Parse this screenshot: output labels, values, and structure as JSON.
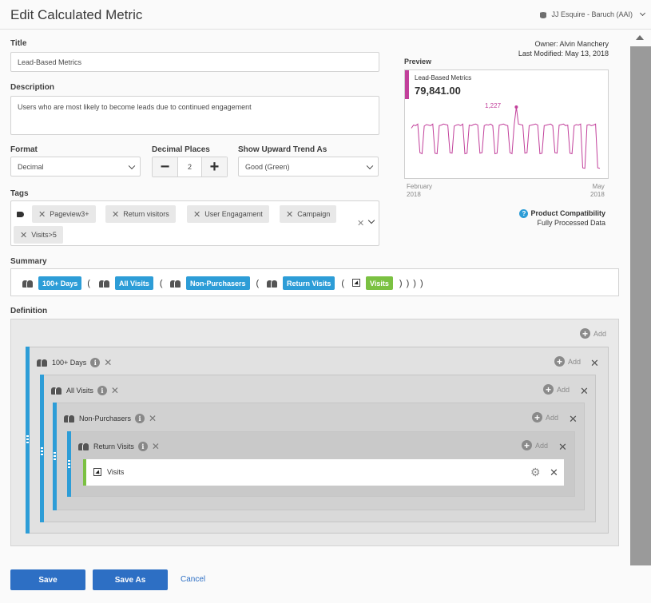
{
  "header": {
    "title": "Edit Calculated Metric",
    "account": "JJ Esquire - Baruch (AAI)"
  },
  "form": {
    "title_label": "Title",
    "title_value": "Lead-Based Metrics",
    "description_label": "Description",
    "description_value": "Users who are most likely to become leads due to continued engagement",
    "format_label": "Format",
    "format_value": "Decimal",
    "decimal_label": "Decimal Places",
    "decimal_value": "2",
    "trend_label": "Show Upward Trend As",
    "trend_value": "Good (Green)",
    "tags_label": "Tags",
    "tags": [
      "Pageview3+",
      "Return visitors",
      "User Engagament",
      "Campaign",
      "Visits>5"
    ]
  },
  "meta": {
    "owner": "Owner: Alvin Manchery",
    "modified": "Last Modified: May 13, 2018"
  },
  "preview": {
    "label": "Preview",
    "metric_name": "Lead-Based Metrics",
    "total": "79,841.00",
    "peak_label": "1,227",
    "start_month": "February",
    "start_year": "2018",
    "end_month": "May",
    "end_year": "2018",
    "line_color": "#c2409b"
  },
  "chart_data": {
    "type": "line",
    "series": [
      {
        "values": [
          820,
          880,
          870,
          900,
          350,
          330,
          860,
          890,
          880,
          870,
          900,
          340,
          330,
          870,
          880,
          900,
          890,
          880,
          350,
          340,
          860,
          880,
          890,
          870,
          900,
          330,
          340,
          880,
          870,
          890,
          900,
          880,
          340,
          350,
          870,
          890,
          880,
          900,
          870,
          330,
          340,
          880,
          890,
          900,
          880,
          870,
          350,
          330,
          880,
          1227,
          900,
          890,
          880,
          340,
          350,
          870,
          880,
          890,
          900,
          880,
          330,
          340,
          870,
          880,
          890,
          900,
          870,
          350,
          340,
          880,
          890,
          900,
          870,
          880,
          340,
          330,
          870,
          890,
          880,
          900,
          60,
          50,
          880,
          890,
          870,
          880,
          900,
          60,
          50
        ]
      }
    ],
    "x_start": "February 2018",
    "x_end": "May 2018"
  },
  "compat": {
    "title": "Product Compatibility",
    "value": "Fully Processed Data"
  },
  "summary": {
    "label": "Summary",
    "items": [
      "100+ Days",
      "All Visits",
      "Non-Purchasers",
      "Return Visits",
      "Visits"
    ],
    "closing": ") ) ) )"
  },
  "definition": {
    "label": "Definition",
    "add_label": "Add",
    "containers": [
      "100+ Days",
      "All Visits",
      "Non-Purchasers",
      "Return Visits"
    ],
    "metric": "Visits"
  },
  "footer": {
    "save": "Save",
    "save_as": "Save As",
    "cancel": "Cancel"
  },
  "colors": {
    "accent_blue": "#2d9dd7",
    "metric_green": "#7bc142",
    "button_blue": "#2d6fc4"
  }
}
